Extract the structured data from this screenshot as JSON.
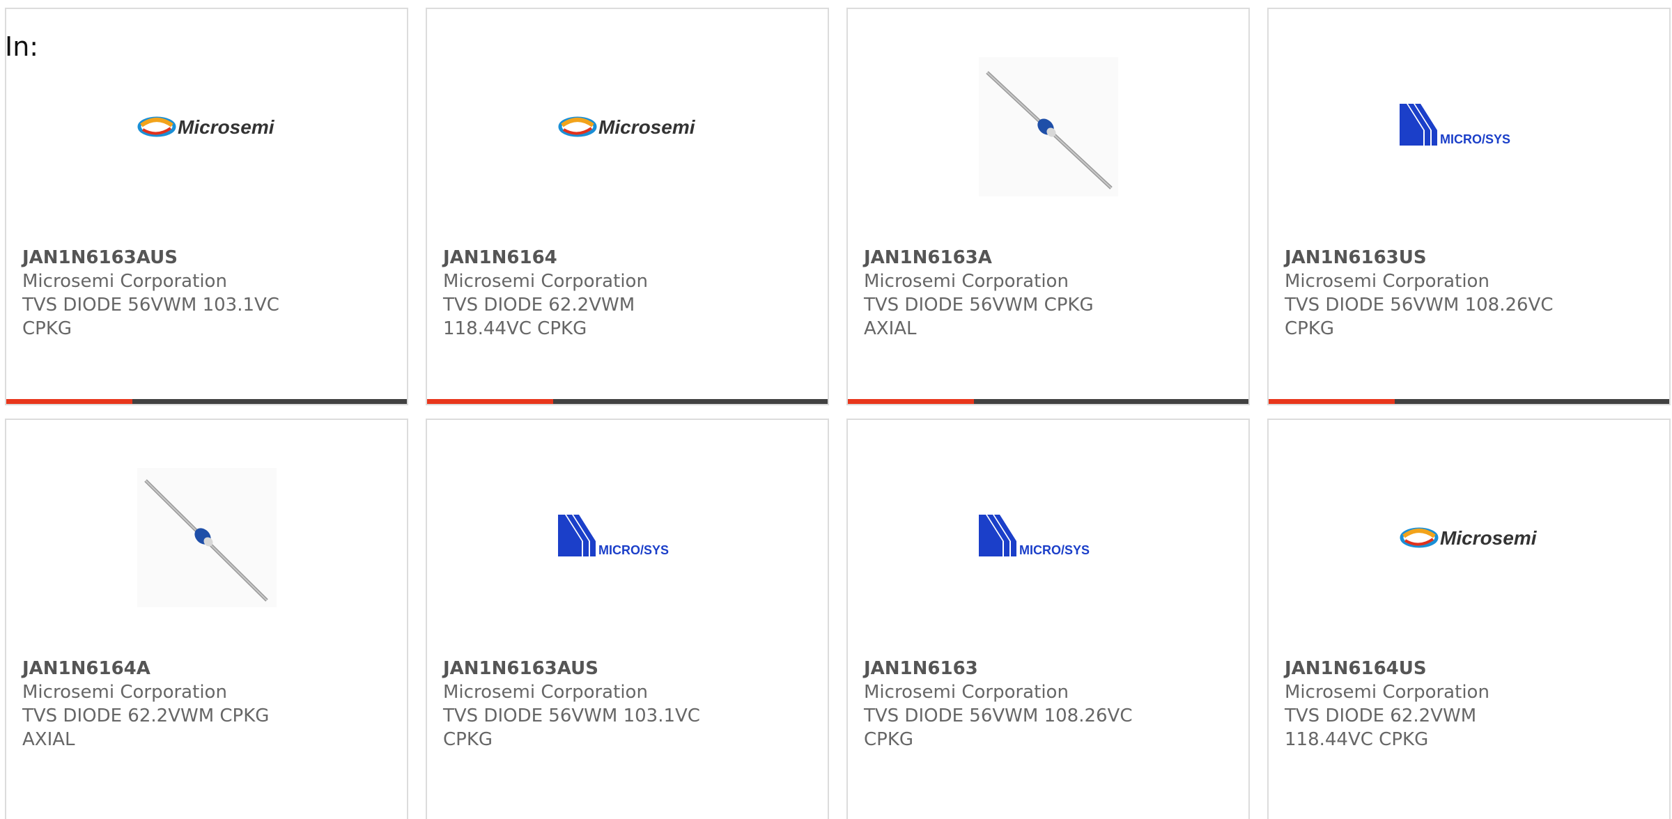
{
  "filter": {
    "label": "In:"
  },
  "colors": {
    "accent": "#e8361c",
    "bar": "#414141",
    "border": "#dcdcdc",
    "text": "#666666"
  },
  "products": [
    {
      "part_number": "JAN1N6163AUS",
      "manufacturer": "Microsemi Corporation",
      "description": "TVS DIODE 56VWM 103.1VC CPKG",
      "image": "microsemi-logo",
      "logo_text": "Microsemi"
    },
    {
      "part_number": "JAN1N6164",
      "manufacturer": "Microsemi Corporation",
      "description": "TVS DIODE 62.2VWM 118.44VC CPKG",
      "image": "microsemi-logo",
      "logo_text": "Microsemi"
    },
    {
      "part_number": "JAN1N6163A",
      "manufacturer": "Microsemi Corporation",
      "description": "TVS DIODE 56VWM CPKG AXIAL",
      "image": "axial-diode-photo"
    },
    {
      "part_number": "JAN1N6163US",
      "manufacturer": "Microsemi Corporation",
      "description": "TVS DIODE 56VWM 108.26VC CPKG",
      "image": "microsys-logo",
      "logo_text": "MICRO/SYS"
    },
    {
      "part_number": "JAN1N6164A",
      "manufacturer": "Microsemi Corporation",
      "description": "TVS DIODE 62.2VWM CPKG AXIAL",
      "image": "axial-diode-photo"
    },
    {
      "part_number": "JAN1N6163AUS",
      "manufacturer": "Microsemi Corporation",
      "description": "TVS DIODE 56VWM 103.1VC CPKG",
      "image": "microsys-logo",
      "logo_text": "MICRO/SYS"
    },
    {
      "part_number": "JAN1N6163",
      "manufacturer": "Microsemi Corporation",
      "description": "TVS DIODE 56VWM 108.26VC CPKG",
      "image": "microsys-logo",
      "logo_text": "MICRO/SYS"
    },
    {
      "part_number": "JAN1N6164US",
      "manufacturer": "Microsemi Corporation",
      "description": "TVS DIODE 62.2VWM 118.44VC CPKG",
      "image": "microsemi-logo",
      "logo_text": "Microsemi"
    }
  ]
}
